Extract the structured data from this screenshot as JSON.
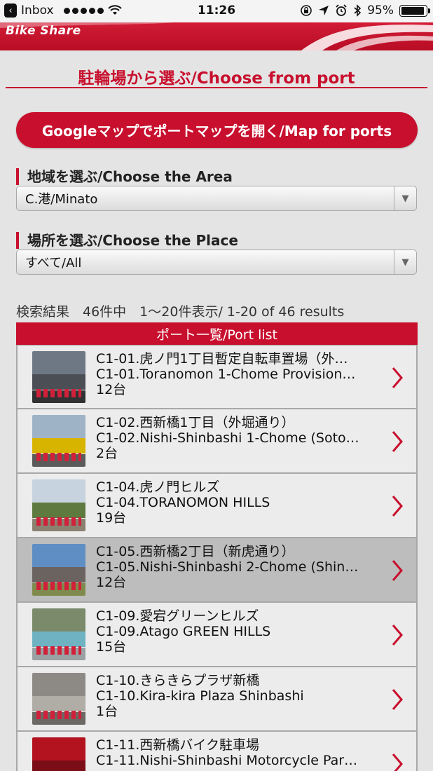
{
  "status_bar": {
    "back_app": "Inbox",
    "time": "11:26",
    "battery": "95%",
    "battery_level": 0.95
  },
  "header": {
    "logo_text": "Bike Share"
  },
  "page": {
    "section_title": "駐輪場から選ぶ/Choose from port",
    "map_button": "Googleマップでポートマップを開く/Map for ports",
    "area_label": "地域を選ぶ/Choose the Area",
    "area_value": "C.港/Minato",
    "place_label": "場所を選ぶ/Choose the Place",
    "place_value": "すべて/All",
    "results": "検索結果　46件中　1〜20件表示/ 1-20 of 46 results",
    "list_header": "ポート一覧/Port list"
  },
  "ports": [
    {
      "name_ja": "C1-01.虎ノ門1丁目暫定自転車置場（外…",
      "name_en": "C1-01.Toranomon 1-Chome Provision…",
      "count": "12台",
      "selected": false
    },
    {
      "name_ja": "C1-02.西新橋1丁目（外堀通り）",
      "name_en": "C1-02.Nishi-Shinbashi 1-Chome (Soto…",
      "count": "2台",
      "selected": false
    },
    {
      "name_ja": "C1-04.虎ノ門ヒルズ",
      "name_en": "C1-04.TORANOMON HILLS",
      "count": "19台",
      "selected": false
    },
    {
      "name_ja": "C1-05.西新橋2丁目（新虎通り）",
      "name_en": "C1-05.Nishi-Shinbashi 2-Chome (Shin…",
      "count": "12台",
      "selected": true
    },
    {
      "name_ja": "C1-09.愛宕グリーンヒルズ",
      "name_en": "C1-09.Atago GREEN HILLS",
      "count": "15台",
      "selected": false
    },
    {
      "name_ja": "C1-10.きらきらプラザ新橋",
      "name_en": "C1-10.Kira-kira Plaza Shinbashi",
      "count": "1台",
      "selected": false
    },
    {
      "name_ja": "C1-11.西新橋バイク駐車場",
      "name_en": "C1-11.Nishi-Shinbashi Motorcycle Par…",
      "count": "",
      "selected": false
    }
  ],
  "colors": {
    "brand_red": "#c8102e",
    "background": "#e4e4e4"
  },
  "icons": [
    "wifi-icon",
    "lock-rotation-icon",
    "location-arrow-icon",
    "alarm-icon",
    "bluetooth-icon",
    "chevron-right-icon"
  ]
}
